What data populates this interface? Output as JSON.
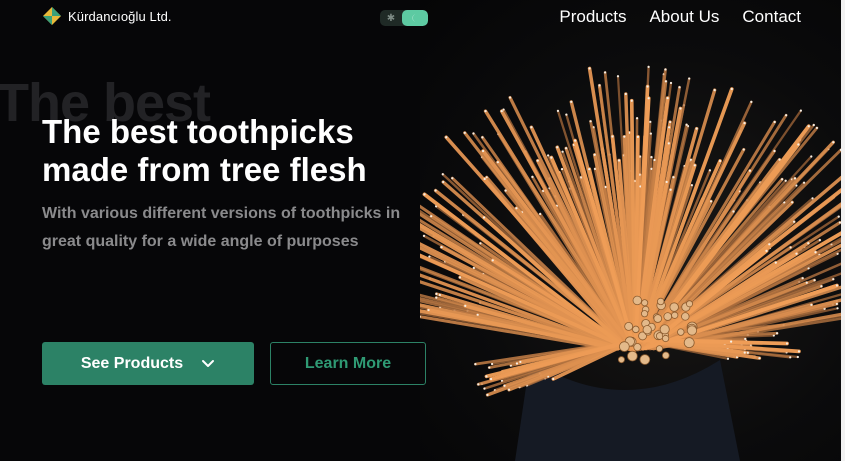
{
  "brand": {
    "name": "Kürdancıoğlu Ltd.",
    "logo_icon": "diamond-logo-icon"
  },
  "theme_toggle": {
    "light_icon": "sun-icon",
    "dark_icon": "moon-icon",
    "state": "dark"
  },
  "nav": {
    "items": [
      {
        "label": "Products"
      },
      {
        "label": "About Us"
      },
      {
        "label": "Contact"
      }
    ]
  },
  "hero": {
    "ghost_text": "The best",
    "headline": "The best toothpicks made from tree flesh",
    "subheadline": "With various different versions of toothpicks in great quality for a wide angle of purposes",
    "primary_button": {
      "label": "See Products",
      "icon": "chevron-down-icon"
    },
    "secondary_button": {
      "label": "Learn More"
    },
    "image": {
      "subject": "bundle of toothpicks"
    }
  },
  "colors": {
    "background": "#060608",
    "accent": "#2c8266",
    "accent_light": "#5dcaa2",
    "logo_yellow": "#e8b93a",
    "logo_green": "#3aa07a"
  }
}
